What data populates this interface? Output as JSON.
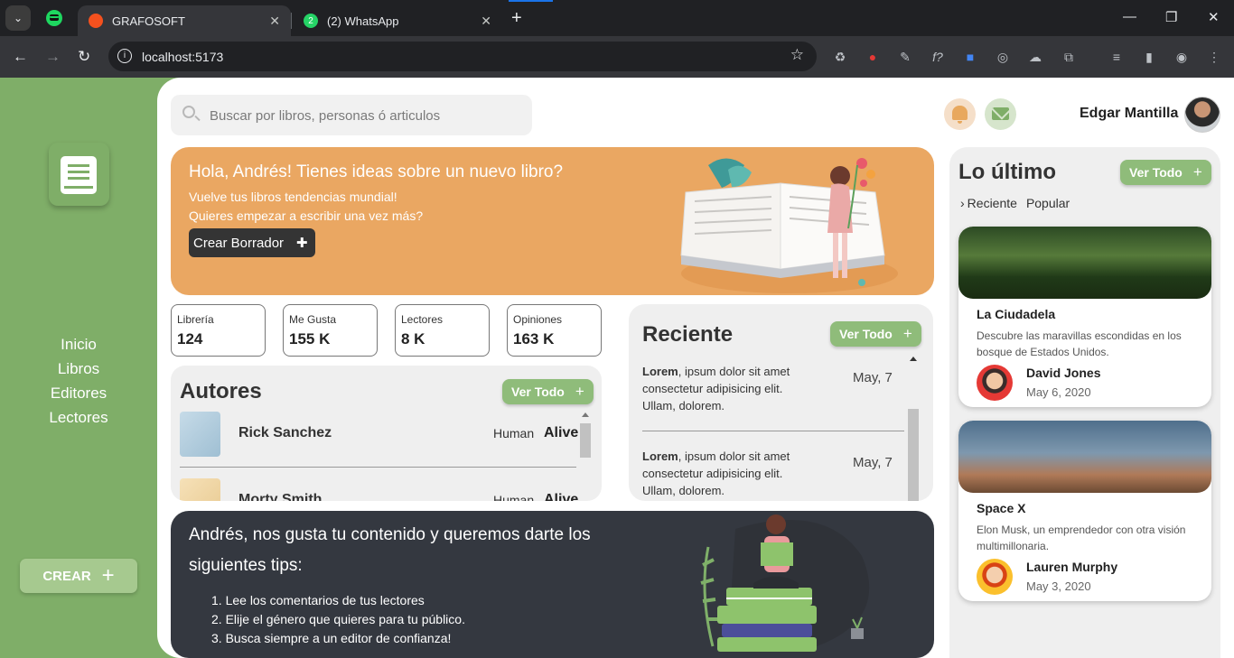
{
  "browser": {
    "tabs": [
      {
        "title": "GRAFOSOFT",
        "active": true
      },
      {
        "title": "(2) WhatsApp",
        "active": false,
        "badge": "2"
      }
    ],
    "url": "localhost:5173"
  },
  "sidebar": {
    "nav": [
      "Inicio",
      "Libros",
      "Editores",
      "Lectores"
    ],
    "create_label": "CREAR"
  },
  "header": {
    "search_placeholder": "Buscar por libros, personas ó articulos",
    "user_name": "Edgar Mantilla"
  },
  "hero": {
    "title": "Hola, Andrés! Tienes ideas sobre un nuevo libro?",
    "line1": "Vuelve tus libros tendencias mundial!",
    "line2": "Quieres empezar a escribir una vez más?",
    "button": "Crear Borrador"
  },
  "stats": [
    {
      "label": "Librería",
      "value": "124"
    },
    {
      "label": "Me Gusta",
      "value": "155 K"
    },
    {
      "label": "Lectores",
      "value": "8 K"
    },
    {
      "label": "Opiniones",
      "value": "163 K"
    }
  ],
  "autores": {
    "title": "Autores",
    "ver_todo": "Ver Todo",
    "items": [
      {
        "name": "Rick Sanchez",
        "species": "Human",
        "status": "Alive"
      },
      {
        "name": "Morty Smith",
        "species": "Human",
        "status": "Alive"
      }
    ]
  },
  "reciente": {
    "title": "Reciente",
    "ver_todo": "Ver Todo",
    "items": [
      {
        "bold": "Lorem",
        "text": ", ipsum dolor sit amet consectetur adipisicing elit. Ullam, dolorem.",
        "date": "May, 7"
      },
      {
        "bold": "Lorem",
        "text": ", ipsum dolor sit amet consectetur adipisicing elit. Ullam, dolorem.",
        "date": "May, 7"
      }
    ]
  },
  "tips": {
    "title": "Andrés, nos gusta tu contenido y queremos darte los siguientes tips:",
    "items": [
      "1. Lee los comentarios de tus lectores",
      "2. Elije el género que quieres para tu público.",
      "3. Busca siempre a un editor de confianza!"
    ]
  },
  "ultimo": {
    "title": "Lo último",
    "ver_todo": "Ver Todo",
    "tabs": [
      "Reciente",
      "Popular"
    ],
    "posts": [
      {
        "title": "La Ciudadela",
        "desc": "Descubre las maravillas escondidas en los bosque de Estados Unidos.",
        "author": "David Jones",
        "date": "May 6, 2020"
      },
      {
        "title": "Space X",
        "desc": "Elon Musk, un emprendedor con otra visión multimillonaria.",
        "author": "Lauren Murphy",
        "date": "May 3, 2020"
      }
    ]
  },
  "colors": {
    "brand_green": "#7fae68",
    "hero_orange": "#eaa762",
    "tips_dark": "#343840"
  }
}
